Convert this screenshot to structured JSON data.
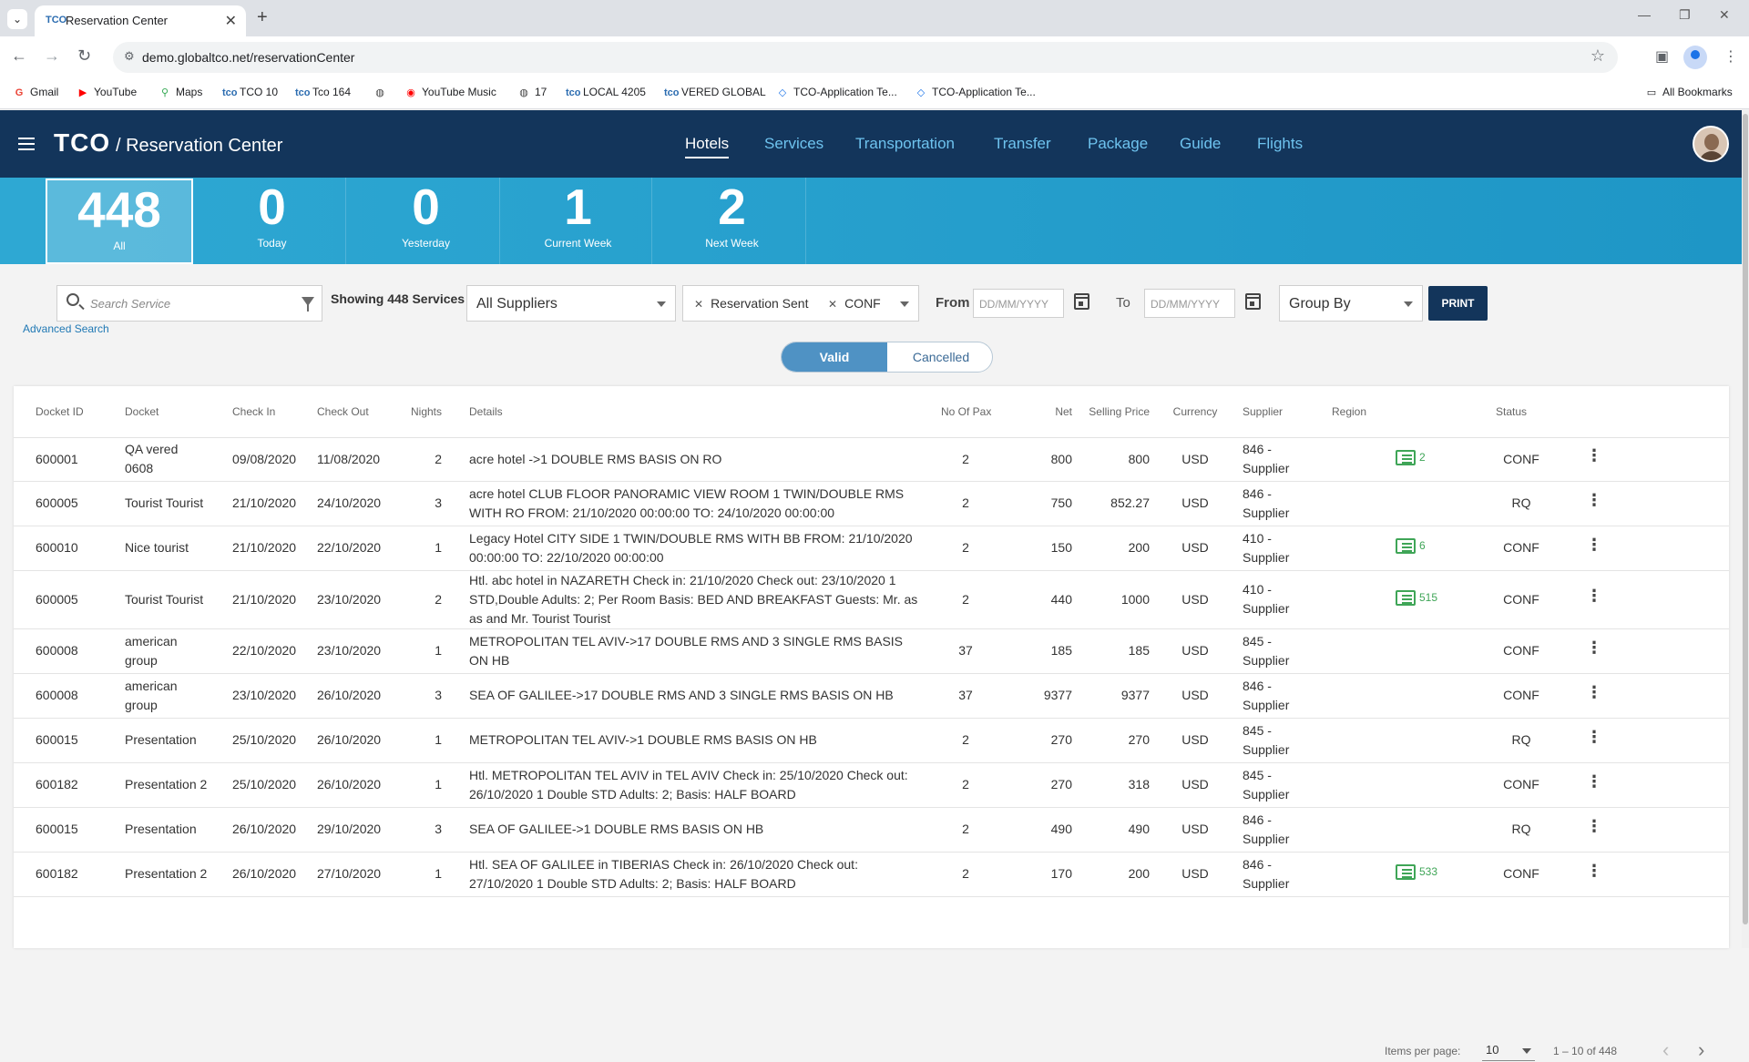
{
  "browser": {
    "tab_title": "Reservation Center",
    "tab_favicon": "TCO",
    "url": "demo.globaltco.net/reservationCenter",
    "bookmarks": [
      {
        "label": "Gmail",
        "icon": "G"
      },
      {
        "label": "YouTube",
        "icon": "▶"
      },
      {
        "label": "Maps",
        "icon": "⚲"
      },
      {
        "label": "TCO 10",
        "icon": "tco"
      },
      {
        "label": "Tco 164",
        "icon": "tco"
      },
      {
        "label": "",
        "icon": "◍"
      },
      {
        "label": "YouTube Music",
        "icon": "◉"
      },
      {
        "label": "17",
        "icon": "◍"
      },
      {
        "label": "LOCAL 4205",
        "icon": "tco"
      },
      {
        "label": "VERED GLOBAL",
        "icon": "tco"
      },
      {
        "label": "TCO-Application Te...",
        "icon": "◇"
      },
      {
        "label": "TCO-Application Te...",
        "icon": "◇"
      }
    ],
    "all_bookmarks": "All Bookmarks"
  },
  "header": {
    "brand": "TCO",
    "crumb": "/ Reservation Center",
    "nav": [
      "Hotels",
      "Services",
      "Transportation",
      "Transfer",
      "Package",
      "Guide",
      "Flights"
    ],
    "active_nav": "Hotels"
  },
  "counters": [
    {
      "value": "448",
      "label": "All"
    },
    {
      "value": "0",
      "label": "Today"
    },
    {
      "value": "0",
      "label": "Yesterday"
    },
    {
      "value": "1",
      "label": "Current Week"
    },
    {
      "value": "2",
      "label": "Next Week"
    }
  ],
  "filters": {
    "search_placeholder": "Search Service",
    "advanced_search": "Advanced Search",
    "showing": "Showing 448 Services",
    "supplier": "All Suppliers",
    "status_chips": [
      "Reservation Sent",
      "CONF"
    ],
    "from_label": "From",
    "to_label": "To",
    "date_placeholder": "DD/MM/YYYY",
    "group_by": "Group By",
    "print": "PRINT",
    "toggle_valid": "Valid",
    "toggle_cancelled": "Cancelled"
  },
  "table": {
    "columns": [
      "Docket ID",
      "Docket",
      "Check In",
      "Check Out",
      "Nights",
      "Details",
      "No Of Pax",
      "Net",
      "Selling Price",
      "Currency",
      "Supplier",
      "Region",
      "",
      "Status",
      ""
    ],
    "rows": [
      {
        "docket_id": "600001",
        "docket": "QA vered 0608",
        "check_in": "09/08/2020",
        "check_out": "11/08/2020",
        "nights": "2",
        "details": "acre hotel ->1 DOUBLE RMS BASIS ON RO",
        "pax": "2",
        "net": "800",
        "selling": "800",
        "currency": "USD",
        "supplier": "846 - Supplier",
        "region": "",
        "notes": "2",
        "status": "CONF"
      },
      {
        "docket_id": "600005",
        "docket": "Tourist Tourist",
        "check_in": "21/10/2020",
        "check_out": "24/10/2020",
        "nights": "3",
        "details": "acre hotel CLUB FLOOR PANORAMIC VIEW ROOM 1 TWIN/DOUBLE RMS WITH RO FROM: 21/10/2020 00:00:00 TO: 24/10/2020 00:00:00",
        "pax": "2",
        "net": "750",
        "selling": "852.27",
        "currency": "USD",
        "supplier": "846 - Supplier",
        "region": "",
        "notes": "",
        "status": "RQ"
      },
      {
        "docket_id": "600010",
        "docket": "Nice tourist",
        "check_in": "21/10/2020",
        "check_out": "22/10/2020",
        "nights": "1",
        "details": "Legacy Hotel CITY SIDE 1 TWIN/DOUBLE RMS WITH BB FROM: 21/10/2020 00:00:00 TO: 22/10/2020 00:00:00",
        "pax": "2",
        "net": "150",
        "selling": "200",
        "currency": "USD",
        "supplier": "410 - Supplier",
        "region": "",
        "notes": "6",
        "status": "CONF"
      },
      {
        "docket_id": "600005",
        "docket": "Tourist Tourist",
        "check_in": "21/10/2020",
        "check_out": "23/10/2020",
        "nights": "2",
        "details": "Htl. abc hotel in NAZARETH Check in: 21/10/2020 Check out: 23/10/2020 1 STD,Double Adults: 2; Per Room Basis: BED AND BREAKFAST Guests: Mr. as as and Mr. Tourist Tourist",
        "pax": "2",
        "net": "440",
        "selling": "1000",
        "currency": "USD",
        "supplier": "410 - Supplier",
        "region": "",
        "notes": "515",
        "status": "CONF"
      },
      {
        "docket_id": "600008",
        "docket": "american group",
        "check_in": "22/10/2020",
        "check_out": "23/10/2020",
        "nights": "1",
        "details": "METROPOLITAN TEL AVIV->17 DOUBLE RMS AND 3 SINGLE RMS BASIS ON HB",
        "pax": "37",
        "net": "185",
        "selling": "185",
        "currency": "USD",
        "supplier": "845 - Supplier",
        "region": "",
        "notes": "",
        "status": "CONF"
      },
      {
        "docket_id": "600008",
        "docket": "american group",
        "check_in": "23/10/2020",
        "check_out": "26/10/2020",
        "nights": "3",
        "details": "SEA OF GALILEE->17 DOUBLE RMS AND 3 SINGLE RMS BASIS ON HB",
        "pax": "37",
        "net": "9377",
        "selling": "9377",
        "currency": "USD",
        "supplier": "846 - Supplier",
        "region": "",
        "notes": "",
        "status": "CONF"
      },
      {
        "docket_id": "600015",
        "docket": "Presentation",
        "check_in": "25/10/2020",
        "check_out": "26/10/2020",
        "nights": "1",
        "details": "METROPOLITAN TEL AVIV->1 DOUBLE RMS BASIS ON HB",
        "pax": "2",
        "net": "270",
        "selling": "270",
        "currency": "USD",
        "supplier": "845 - Supplier",
        "region": "",
        "notes": "",
        "status": "RQ"
      },
      {
        "docket_id": "600182",
        "docket": "Presentation 2",
        "check_in": "25/10/2020",
        "check_out": "26/10/2020",
        "nights": "1",
        "details": "Htl. METROPOLITAN TEL AVIV in TEL AVIV Check in: 25/10/2020 Check out: 26/10/2020 1 Double STD Adults: 2; Basis: HALF BOARD",
        "pax": "2",
        "net": "270",
        "selling": "318",
        "currency": "USD",
        "supplier": "845 - Supplier",
        "region": "",
        "notes": "",
        "status": "CONF"
      },
      {
        "docket_id": "600015",
        "docket": "Presentation",
        "check_in": "26/10/2020",
        "check_out": "29/10/2020",
        "nights": "3",
        "details": "SEA OF GALILEE->1 DOUBLE RMS BASIS ON HB",
        "pax": "2",
        "net": "490",
        "selling": "490",
        "currency": "USD",
        "supplier": "846 - Supplier",
        "region": "",
        "notes": "",
        "status": "RQ"
      },
      {
        "docket_id": "600182",
        "docket": "Presentation 2",
        "check_in": "26/10/2020",
        "check_out": "27/10/2020",
        "nights": "1",
        "details": "Htl. SEA OF GALILEE in TIBERIAS Check in: 26/10/2020 Check out: 27/10/2020 1 Double STD Adults: 2; Basis: HALF BOARD",
        "pax": "2",
        "net": "170",
        "selling": "200",
        "currency": "USD",
        "supplier": "846 - Supplier",
        "region": "",
        "notes": "533",
        "status": "CONF"
      }
    ]
  },
  "pagination": {
    "items_per_page_label": "Items per page:",
    "items_per_page": "10",
    "range": "1 – 10 of 448"
  }
}
